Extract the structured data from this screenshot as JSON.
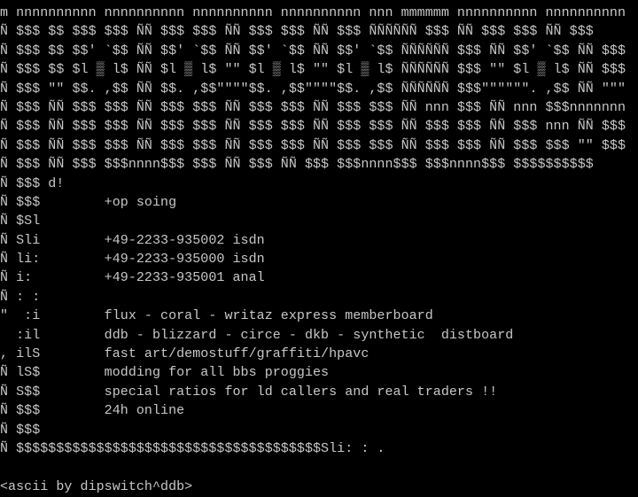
{
  "terminal": {
    "colors": {
      "background": "#000000",
      "text": "#c8c8c8"
    },
    "logo_lines": [
      "m nnnnnnnnnn nnnnnnnnnn nnnnnnnnnn nnnnnnnnnn nnn mmmmmm nnnnnnnnnn nnnnnnnnnn",
      "Ñ $$$ $$ $$$ $$$ ÑÑ $$$ $$$ ÑÑ $$$ $$$ ÑÑ $$$ ÑÑÑÑÑÑ $$$ ÑÑ $$$ $$$ ÑÑ $$$",
      "Ñ $$$ $$ $$' `$$ ÑÑ $$' `$$ ÑÑ $$' `$$ ÑÑ $$' `$$ ÑÑÑÑÑÑ $$$ ÑÑ $$' `$$ ÑÑ $$$",
      "Ñ $$$ $$ $l ▒ l$ ÑÑ $l ▒ l$ \"\" $l ▒ l$ \"\" $l ▒ l$ ÑÑÑÑÑÑ $$$ \"\" $l ▒ l$ ÑÑ $$$",
      "Ñ $$$ \"\" $$. ,$$ ÑÑ $$. ,$$\"\"\"\"$$. ,$$\"\"\"\"$$. ,$$ ÑÑÑÑÑÑ $$$\"\"\"\"\"\". ,$$ ÑÑ \"\"\"",
      "Ñ $$$ ÑÑ $$$ $$$ ÑÑ $$$ $$$ ÑÑ $$$ $$$ ÑÑ $$$ $$$ ÑÑ nnn $$$ ÑÑ nnn $$$nnnnnnn",
      "Ñ $$$ ÑÑ $$$ $$$ ÑÑ $$$ $$$ ÑÑ $$$ $$$ ÑÑ $$$ $$$ ÑÑ $$$ $$$ ÑÑ $$$ nnn ÑÑ $$$",
      "Ñ $$$ ÑÑ $$$ $$$ ÑÑ $$$ $$$ ÑÑ $$$ $$$ ÑÑ $$$ $$$ ÑÑ $$$ $$$ ÑÑ $$$ $$$ \"\" $$$",
      "Ñ $$$ ÑÑ $$$ $$$nnnn$$$ $$$ ÑÑ $$$ ÑÑ $$$ $$$nnnn$$$ $$$nnnn$$$ $$$$$$$$$$"
    ],
    "info_lines": [
      "Ñ $$$ d!",
      "Ñ $$$        +op soing",
      "Ñ $Sl",
      "Ñ Sli        +49-2233-935002 isdn",
      "Ñ li:        +49-2233-935000 isdn",
      "Ñ i:         +49-2233-935001 anal",
      "Ñ : :",
      "\"  :i        flux - coral - writaz express memberboard",
      "  :il        ddb - blizzard - circe - dkb - synthetic  distboard",
      ", ilS        fast art/demostuff/graffiti/hpavc",
      "Ñ lS$        modding for all bbs proggies",
      "Ñ S$$        special ratios for ld callers and real traders !!",
      "Ñ $$$        24h online",
      "Ñ $$$",
      "Ñ $$$$$$$$$$$$$$$$$$$$$$$$$$$$$$$$$$$$$$Sli: : ."
    ],
    "blank_line": "",
    "credit_line": "<ascii by dipswitch^ddb>"
  }
}
